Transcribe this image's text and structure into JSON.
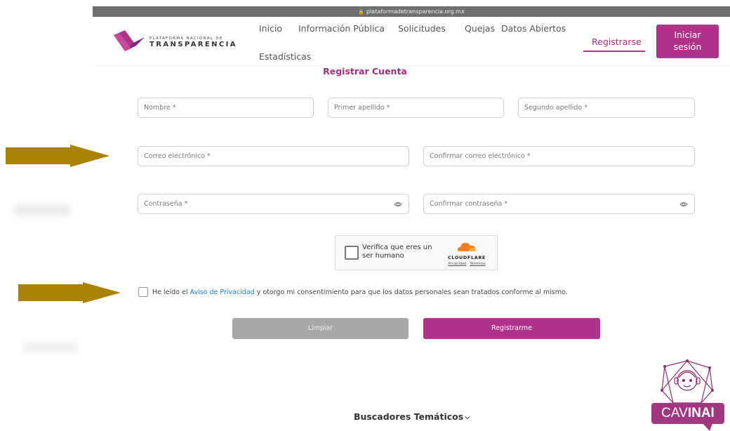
{
  "browser": {
    "url": "plataformadetransparencia.org.mx"
  },
  "brand": {
    "logo_small": "PLATAFORMA NACIONAL DE",
    "logo_big": "TRANSPARENCIA",
    "accent": "#b0338a",
    "accent_dark": "#9d2f7c"
  },
  "nav": {
    "inicio": "Inicio",
    "informacion": "Información Pública",
    "solicitudes": "Solicitudes",
    "quejas": "Quejas",
    "datos": "Datos Abiertos",
    "estadisticas": "Estadísticas",
    "registrarse": "Registrarse",
    "iniciar_line1": "Iniciar",
    "iniciar_line2": "sesión"
  },
  "form": {
    "title": "Registrar Cuenta",
    "nombre_placeholder": "Nombre *",
    "primer_apellido_placeholder": "Primer apellido *",
    "segundo_apellido_placeholder": "Segundo apellido *",
    "correo_placeholder": "Correo electrónico *",
    "confirmar_correo_placeholder": "Confirmar correo electrónico *",
    "contrasena_placeholder": "Contraseña *",
    "confirmar_contrasena_placeholder": "Confirmar contraseña *",
    "consent_prefix": "He leído el ",
    "consent_link": "Aviso de Privacidad",
    "consent_suffix": " y otorgo mi consentimiento para que los datos personales sean tratados conforme al mismo.",
    "clear_label": "Limpiar",
    "register_label": "Registrarme"
  },
  "captcha": {
    "line1": "Verifica que eres un",
    "line2": "ser humano",
    "brand": "CLOUDFLARE",
    "privacy": "Privacidad",
    "separator": " · ",
    "terms": "Términos"
  },
  "footer": {
    "search_label": "Buscadores Temáticos"
  },
  "badge": {
    "part1": "CAV",
    "part2": "INAI"
  },
  "icons": {
    "lock": "lock-icon",
    "eye": "eye-icon",
    "chevron": "chevron-down-icon",
    "cloud": "cloud-icon"
  },
  "colors": {
    "arrow": "#a88200",
    "clear_button": "#a8a8a8",
    "link": "#1a7bd1"
  }
}
